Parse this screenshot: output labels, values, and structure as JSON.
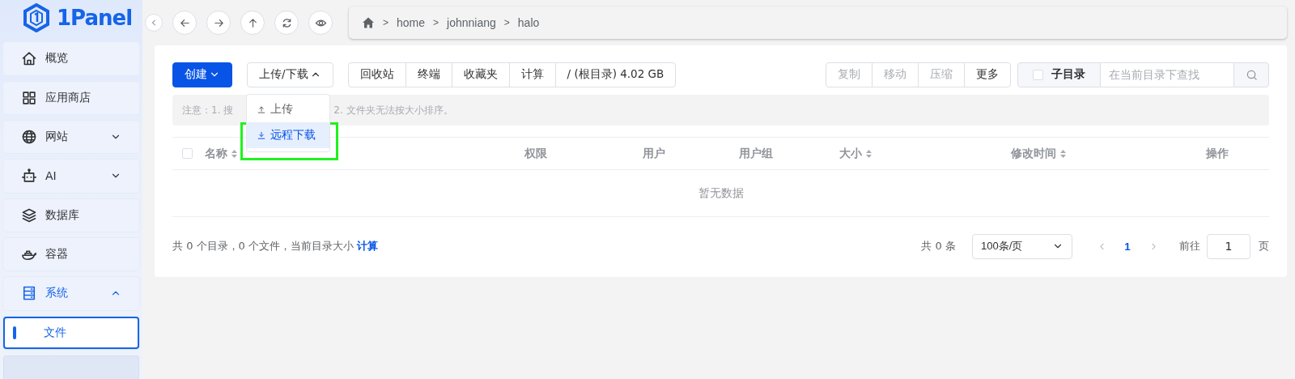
{
  "logo": {
    "text": "1Panel"
  },
  "sidebar": {
    "items": [
      {
        "label": "概览",
        "active": false
      },
      {
        "label": "应用商店",
        "active": false
      },
      {
        "label": "网站",
        "expanded": false,
        "active": false
      },
      {
        "label": "AI",
        "expanded": false,
        "active": false
      },
      {
        "label": "数据库",
        "active": false
      },
      {
        "label": "容器",
        "active": false
      },
      {
        "label": "系统",
        "expanded": true,
        "active": true,
        "children": [
          {
            "label": "文件",
            "selected": true
          }
        ]
      }
    ]
  },
  "breadcrumb": [
    {
      "separator": ">",
      "label": "home"
    },
    {
      "separator": ">",
      "label": "johnniang"
    },
    {
      "separator": ">",
      "label": "halo"
    }
  ],
  "toolbar": {
    "create": {
      "label": "创建"
    },
    "transfer": {
      "label": "上传/下载",
      "expanded": true,
      "menu": [
        {
          "label": "上传",
          "selected": false
        },
        {
          "label": "远程下载",
          "selected": true
        }
      ]
    },
    "group": [
      {
        "label": "回收站"
      },
      {
        "label": "终端"
      },
      {
        "label": "收藏夹"
      },
      {
        "label": "计算"
      },
      {
        "label": "/ (根目录) 4.02 GB"
      }
    ],
    "actions": [
      {
        "label": "复制",
        "disabled": true
      },
      {
        "label": "移动",
        "disabled": true
      },
      {
        "label": "压缩",
        "disabled": true
      },
      {
        "label": "更多",
        "disabled": false
      }
    ],
    "search": {
      "subdir_label": "子目录",
      "subdir_checked": false,
      "placeholder": "在当前目录下查找"
    }
  },
  "notice": {
    "start": "注意：1. 搜",
    "end": "2. 文件夹无法按大小排序。"
  },
  "table": {
    "columns": [
      {
        "label": "名称",
        "sortable": true
      },
      {
        "label": "权限",
        "sortable": false
      },
      {
        "label": "用户",
        "sortable": false
      },
      {
        "label": "用户组",
        "sortable": false
      },
      {
        "label": "大小",
        "sortable": true
      },
      {
        "label": "修改时间",
        "sortable": true
      },
      {
        "label": "操作",
        "sortable": false
      }
    ],
    "all_checked": false,
    "empty_text": "暂无数据"
  },
  "footer": {
    "summary": "共 0 个目录，0 个文件，当前目录大小",
    "compute_link": "计算",
    "total": "共 0 条",
    "page_size": "100条/页",
    "pages": [
      {
        "label": "1",
        "selected": true
      }
    ],
    "goto_label": "前往",
    "goto_value": "1",
    "page_suffix": "页"
  }
}
